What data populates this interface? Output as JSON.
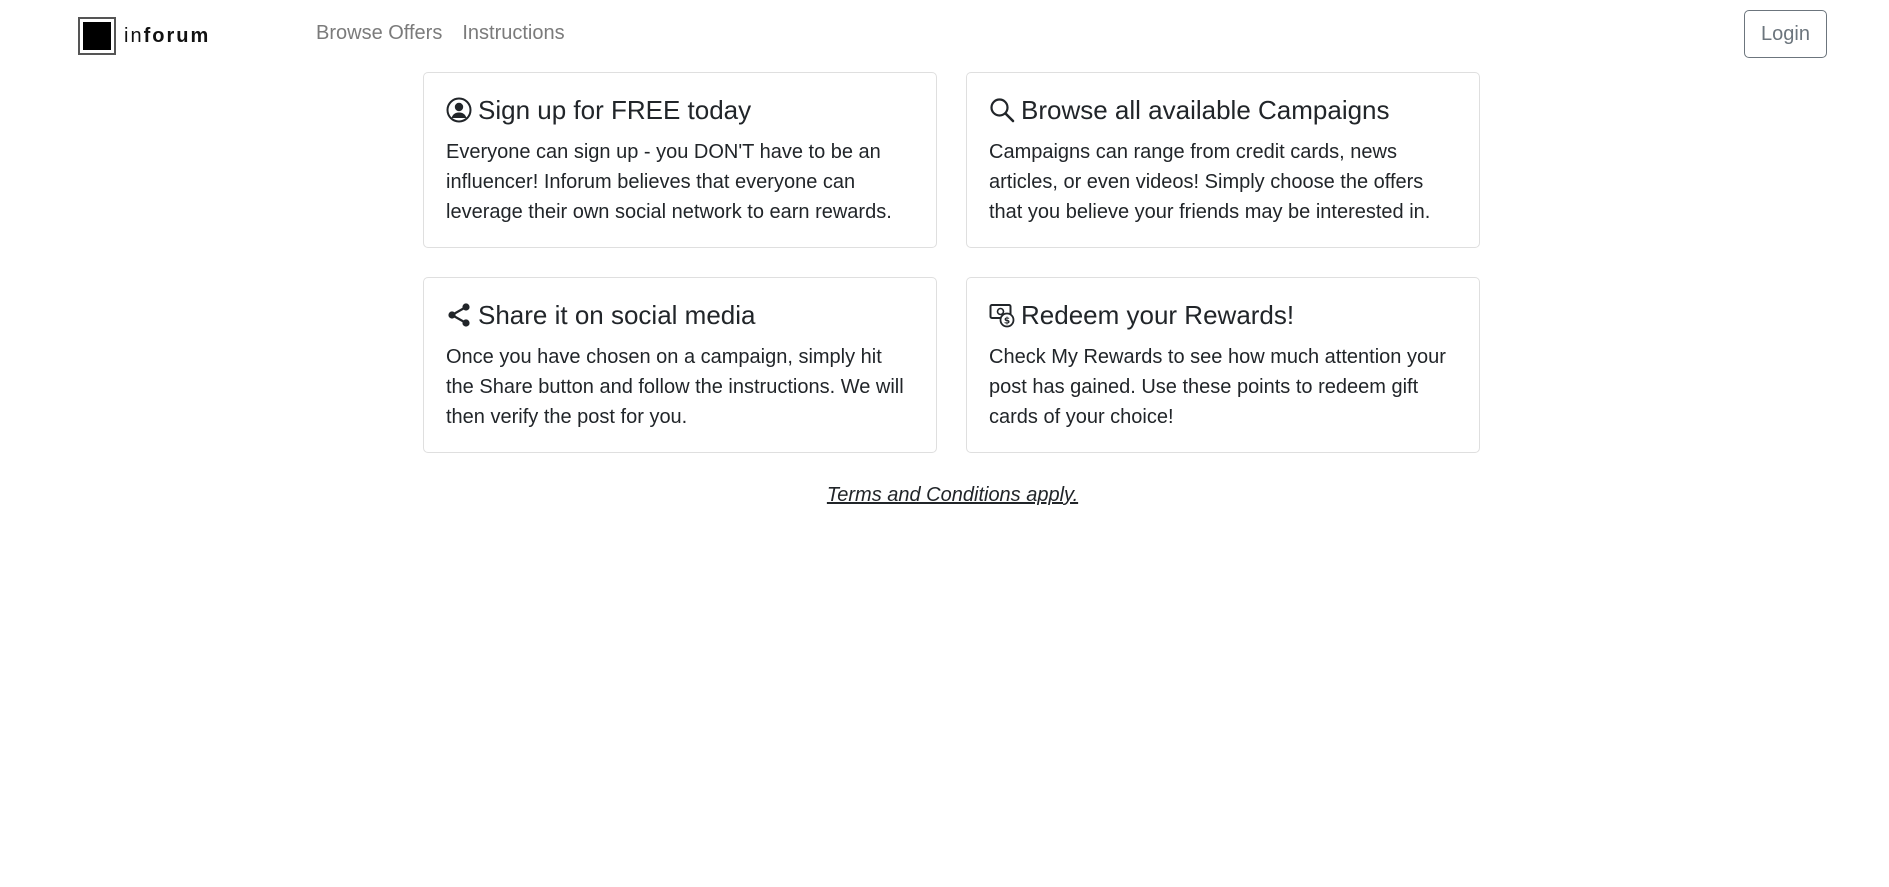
{
  "brand": {
    "name_light": "in",
    "name_bold": "forum"
  },
  "nav": {
    "links": [
      "Browse Offers",
      "Instructions"
    ],
    "login_label": "Login"
  },
  "cards": [
    {
      "icon": "user-circle-icon",
      "title": "Sign up for FREE today",
      "text": "Everyone can sign up - you DON'T have to be an influencer! Inforum believes that everyone can leverage their own social network to earn rewards."
    },
    {
      "icon": "search-icon",
      "title": "Browse all available Campaigns",
      "text": "Campaigns can range from credit cards, news articles, or even videos! Simply choose the offers that you believe your friends may be interested in."
    },
    {
      "icon": "share-icon",
      "title": "Share it on social media",
      "text": "Once you have chosen on a campaign, simply hit the Share button and follow the instructions. We will then verify the post for you."
    },
    {
      "icon": "rewards-cash-icon",
      "title": "Redeem your Rewards!",
      "text": "Check My Rewards to see how much attention your post has gained. Use these points to redeem gift cards of your choice!"
    }
  ],
  "footer": {
    "terms_label": "Terms and Conditions apply."
  }
}
